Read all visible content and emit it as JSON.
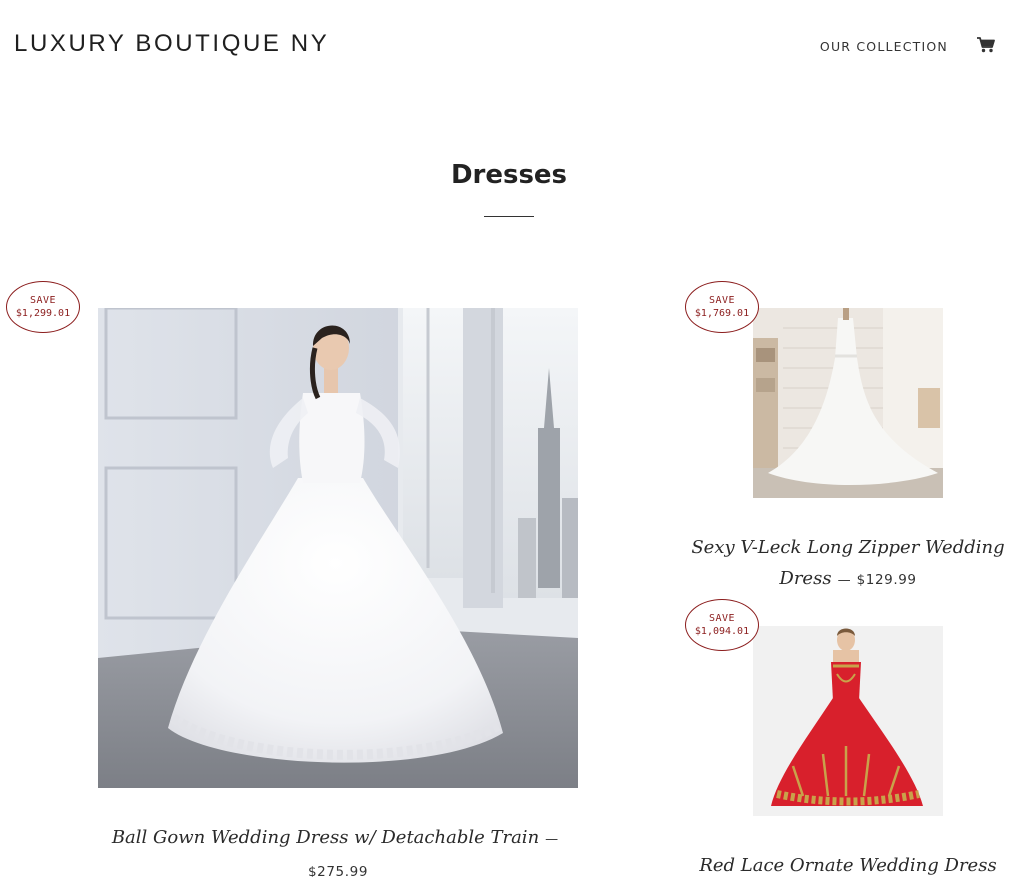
{
  "header": {
    "logo": "LUXURY BOUTIQUE NY",
    "nav_collection": "OUR COLLECTION",
    "cart_icon": "cart-icon"
  },
  "collection": {
    "title": "Dresses"
  },
  "colors": {
    "badge": "#8b1d1d",
    "text": "#222222",
    "red_dress": "#d8202c",
    "gold_trim": "#c9a24a"
  },
  "products": [
    {
      "badge_line1": "SAVE",
      "badge_line2": "$1,299.01",
      "name": "Ball Gown Wedding Dress w/ Detachable Train",
      "dash": "—",
      "price": "$275.99"
    },
    {
      "badge_line1": "SAVE",
      "badge_line2": "$1,769.01",
      "name_line1": "Sexy V-Leck Long Zipper Wedding",
      "name_line2": "Dress",
      "dash": "—",
      "price": "$129.99"
    },
    {
      "badge_line1": "SAVE",
      "badge_line2": "$1,094.01",
      "name": "Red Lace Ornate Wedding Dress"
    }
  ]
}
